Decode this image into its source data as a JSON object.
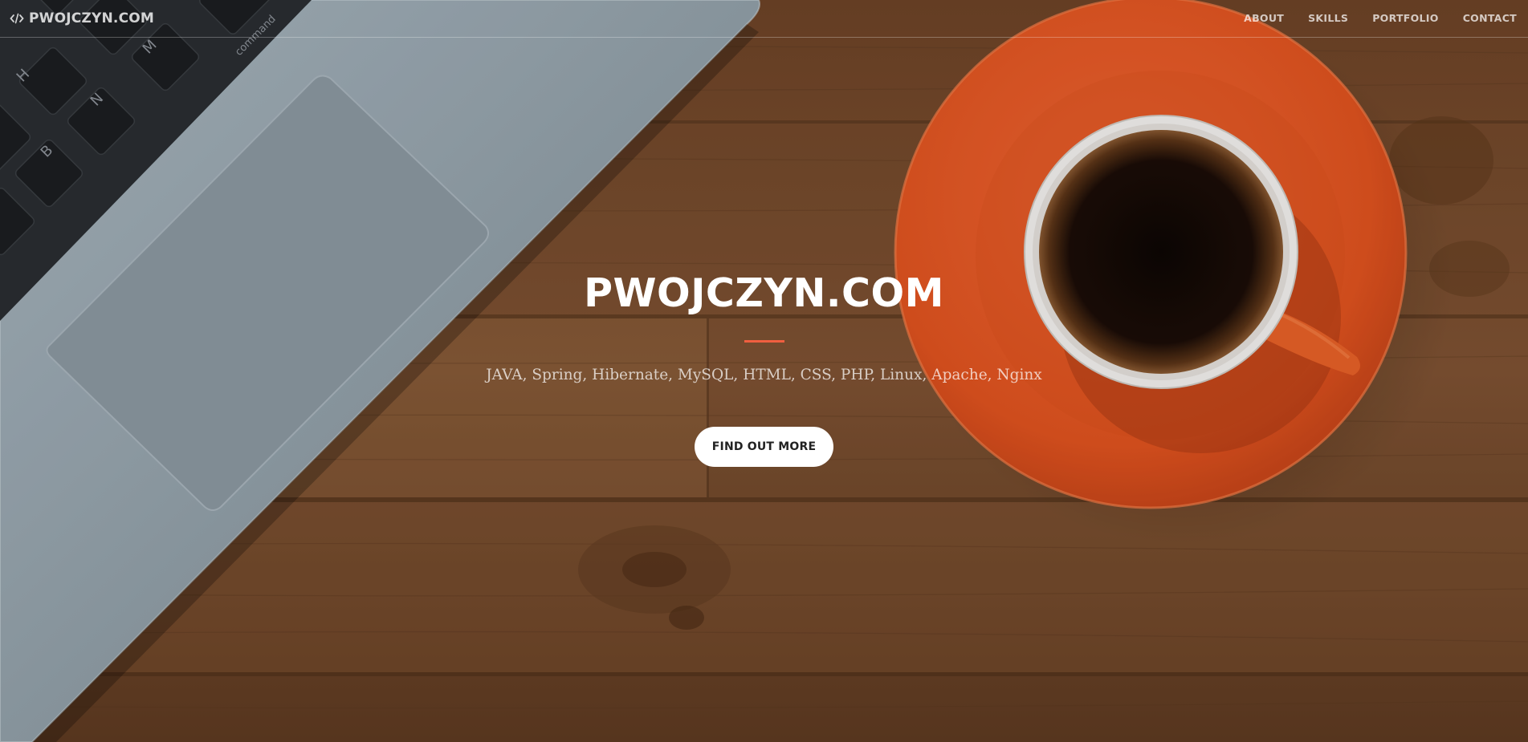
{
  "navbar": {
    "brand_label": "PWOJCZYN.COM",
    "brand_icon": "code-icon",
    "links": [
      {
        "label": "ABOUT"
      },
      {
        "label": "SKILLS"
      },
      {
        "label": "PORTFOLIO"
      },
      {
        "label": "CONTACT"
      }
    ]
  },
  "hero": {
    "title": "PWOJCZYN.COM",
    "subtitle": "JAVA, Spring, Hibernate, MySQL, HTML, CSS, PHP, Linux, Apache, Nginx",
    "button_label": "FIND OUT MORE",
    "accent_color": "#f05f40",
    "background_image": "laptop-and-coffee-cup-on-wooden-desk"
  }
}
